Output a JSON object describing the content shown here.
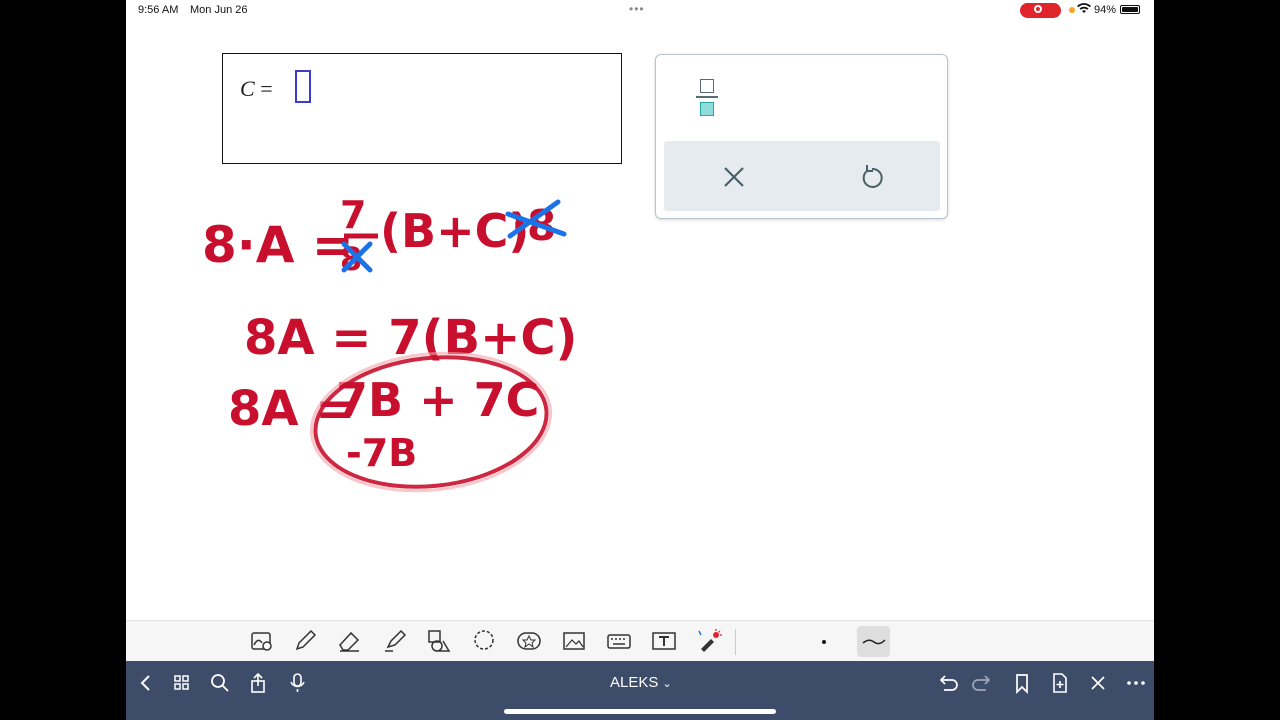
{
  "status_bar": {
    "time": "9:56 AM",
    "date": "Mon Jun 26",
    "battery_percent": "94%"
  },
  "answer_box": {
    "variable": "C",
    "equals": "="
  },
  "keypad": {
    "buttons": [
      "fraction",
      "clear",
      "undo"
    ]
  },
  "handwriting": {
    "line1_left": "8·A =",
    "line1_fraction_numerator": "7",
    "line1_fraction_denominator": "8",
    "line1_right": "(B+C)",
    "line1_crossed": "·8",
    "line2": "8A = 7(B+C)",
    "line3_left": "8A =",
    "line3_right": "7B + 7C",
    "line4": "-7B",
    "ink_color": "#c8102e",
    "cross_color": "#1a73e8"
  },
  "toolbar": {
    "tools": [
      "lasso-zoom",
      "pen",
      "eraser",
      "highlighter",
      "shapes",
      "lasso",
      "stickers",
      "image",
      "keyboard",
      "text",
      "laser-pointer"
    ]
  },
  "nav_bar": {
    "title": "ALEKS",
    "title_caret": "⌄"
  },
  "colors": {
    "nav_bg": "#3d4c68",
    "slot_border": "#3b3bd1",
    "record_red": "#e0242c"
  }
}
